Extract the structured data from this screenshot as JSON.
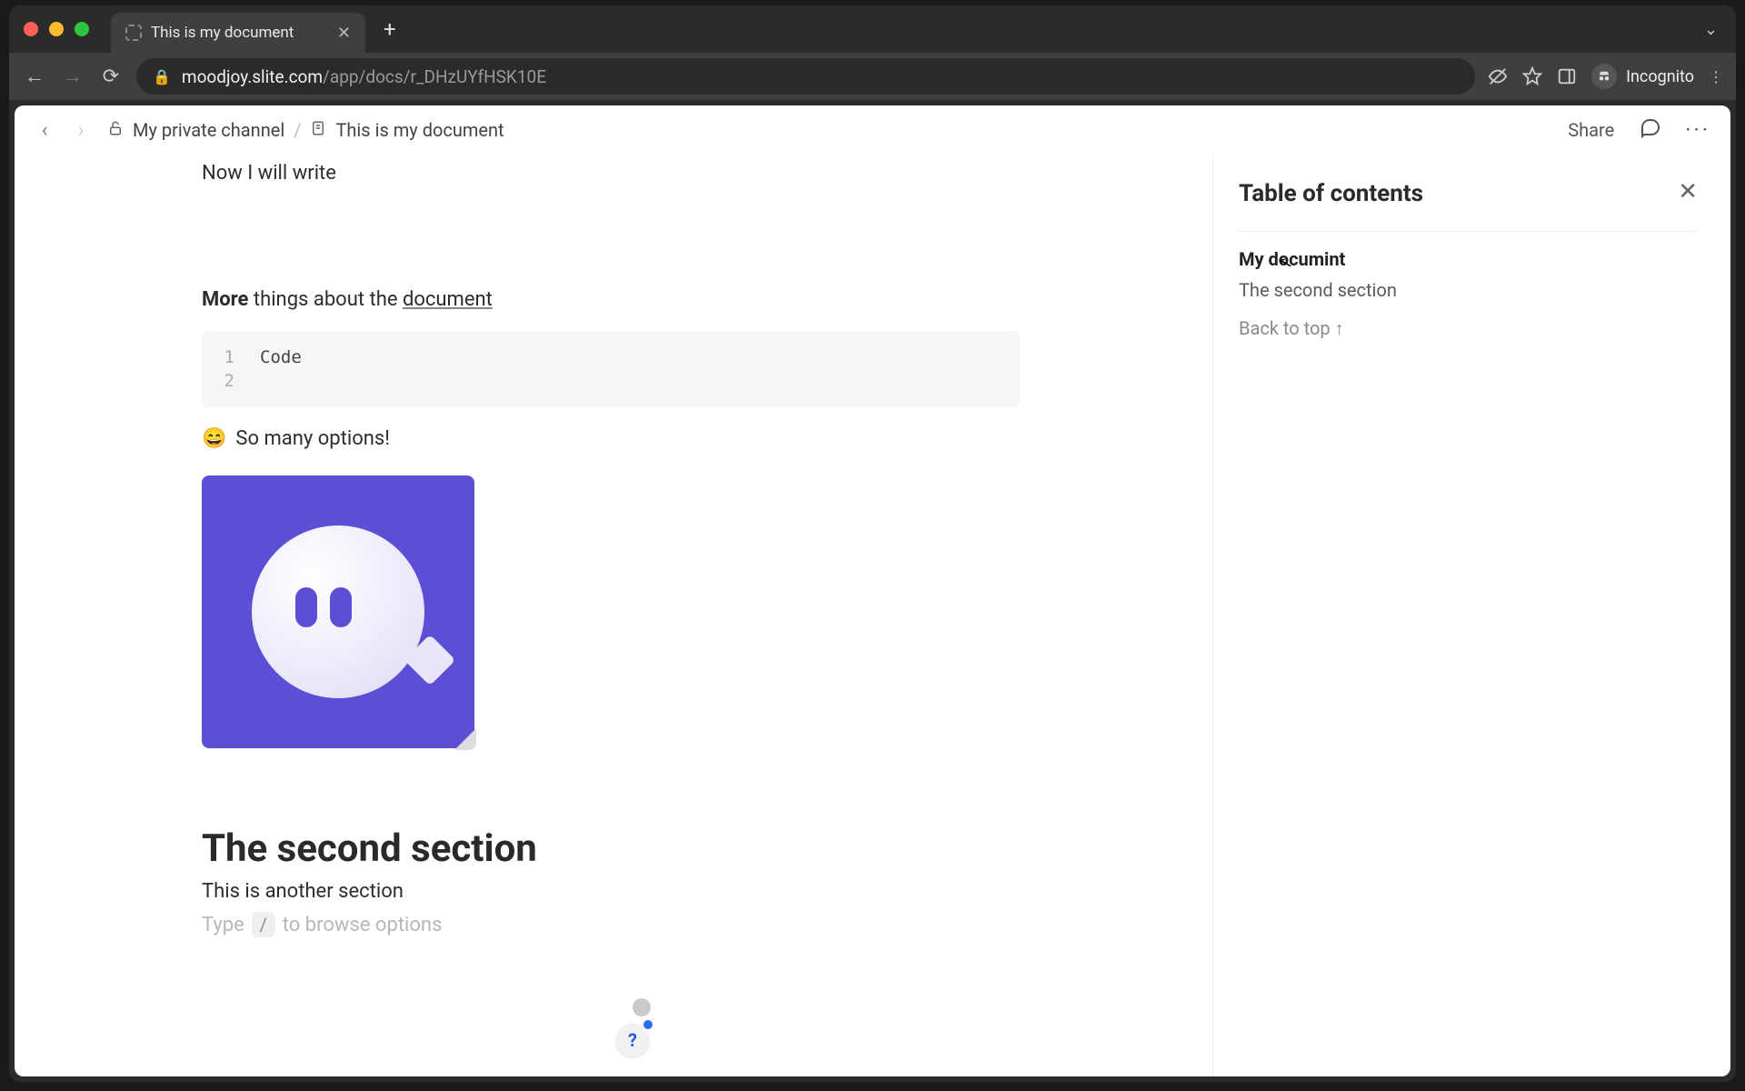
{
  "browser": {
    "tab_title": "This is my document",
    "url_domain": "moodjoy.slite.com",
    "url_path": "/app/docs/r_DHzUYfHSK10E",
    "incognito_label": "Incognito"
  },
  "breadcrumb": {
    "channel": "My private channel",
    "doc": "This is my document",
    "separator": "/"
  },
  "topbar": {
    "share_label": "Share"
  },
  "document": {
    "intro_line": "Now I will write",
    "more_line": {
      "bold": "More",
      "mid": " things about the ",
      "underlined": "document"
    },
    "code": {
      "lines": [
        {
          "n": "1",
          "text": "Code"
        },
        {
          "n": "2",
          "text": ""
        }
      ]
    },
    "emoji_line": {
      "emoji": "😄",
      "text": "So many options!"
    },
    "section2": {
      "heading": "The second section",
      "body": "This is another section"
    },
    "placeholder": {
      "pre": "Type",
      "key": "/",
      "post": "to browse options"
    }
  },
  "toc": {
    "title": "Table of contents",
    "items": [
      {
        "label": "My documint",
        "active": true
      },
      {
        "label": "The second section",
        "active": false
      }
    ],
    "back_label": "Back to top",
    "back_arrow": "↑"
  },
  "help": {
    "glyph": "?"
  }
}
